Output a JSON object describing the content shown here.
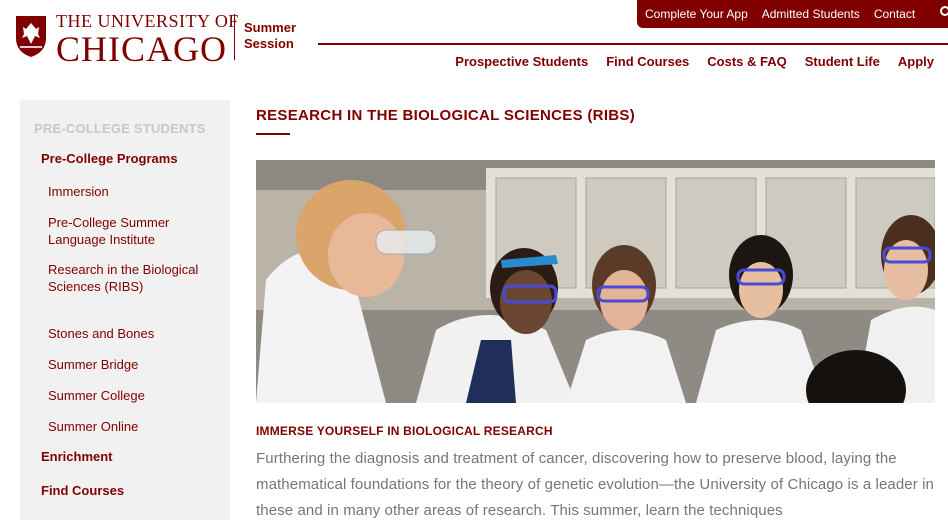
{
  "brand": {
    "wordmark_small": "THE UNIVERSITY OF",
    "wordmark_big": "CHICAGO",
    "session_line1": "Summer",
    "session_line2": "Session",
    "color": "#800000"
  },
  "utility_nav": {
    "items": [
      "Complete Your App",
      "Admitted Students",
      "Contact"
    ],
    "search_icon": "search-icon"
  },
  "main_nav": {
    "items": [
      "Prospective Students",
      "Find Courses",
      "Costs & FAQ",
      "Student Life",
      "Apply"
    ]
  },
  "sidebar": {
    "heading": "PRE-COLLEGE STUDENTS",
    "items": [
      {
        "label": "Pre-College Programs"
      },
      {
        "label": "Immersion"
      },
      {
        "label": "Pre-College Summer Language Institute"
      },
      {
        "label": "Research in the Biological Sciences (RIBS)"
      },
      {
        "label": "Stones and Bones"
      },
      {
        "label": "Summer Bridge"
      },
      {
        "label": "Summer College"
      },
      {
        "label": "Summer Online"
      },
      {
        "label": "Enrichment"
      },
      {
        "label": "Find Courses"
      }
    ]
  },
  "main": {
    "title": "RESEARCH IN THE BIOLOGICAL SCIENCES (RIBS)",
    "section_heading": "IMMERSE YOURSELF IN BIOLOGICAL RESEARCH",
    "body": "Furthering the diagnosis and treatment of cancer, discovering how to preserve blood, laying the mathematical foundations for the theory of genetic evolution—the University of Chicago is a leader in these and in many other areas of research. This summer, learn the techniques"
  }
}
